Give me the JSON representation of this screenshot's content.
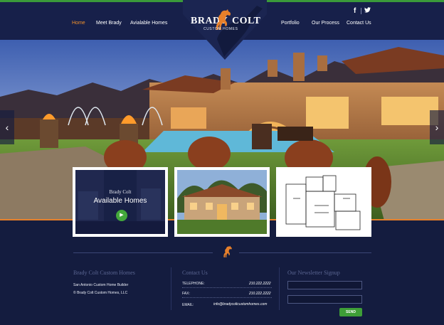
{
  "header": {
    "nav_left": [
      {
        "label": "Home",
        "active": true
      },
      {
        "label": "Meet Brady",
        "active": false
      },
      {
        "label": "Avialable Homes",
        "active": false
      }
    ],
    "nav_right": [
      {
        "label": "Portfolio"
      },
      {
        "label": "Our Process"
      },
      {
        "label": "Contact Us"
      }
    ],
    "logo": {
      "word1": "BRADY",
      "word2": "COLT",
      "tagline": "CUSTOM HOMES"
    },
    "social": [
      {
        "icon": "facebook-icon",
        "glyph": "f"
      },
      {
        "icon": "twitter-icon",
        "glyph": "t"
      }
    ]
  },
  "hero": {
    "prev_arrow": "‹",
    "next_arrow": "›"
  },
  "cards": {
    "available": {
      "title": "Brady Colt",
      "subtitle": "Available Homes",
      "play_icon": "▶"
    }
  },
  "footer": {
    "col1": {
      "heading": "Brady Colt Custom Homes",
      "line1": "San Antonio Custom Home Builder",
      "line2": "© Brady Colt Custom Homes, LLC"
    },
    "col2": {
      "heading": "Contact Us",
      "telephone_label": "TELEPHONE:",
      "telephone_value": "210.222.2222",
      "fax_label": "FAX:",
      "fax_value": "210.222.2222",
      "email_label": "EMAIL:",
      "email_value": "info@bradycoltcustomhomes.com"
    },
    "col3": {
      "heading": "Our Newsletter Signup",
      "send_label": "SEND"
    }
  },
  "colors": {
    "background": "#141c3f",
    "accent_orange": "#e7802b",
    "accent_green": "#3e9e37"
  }
}
